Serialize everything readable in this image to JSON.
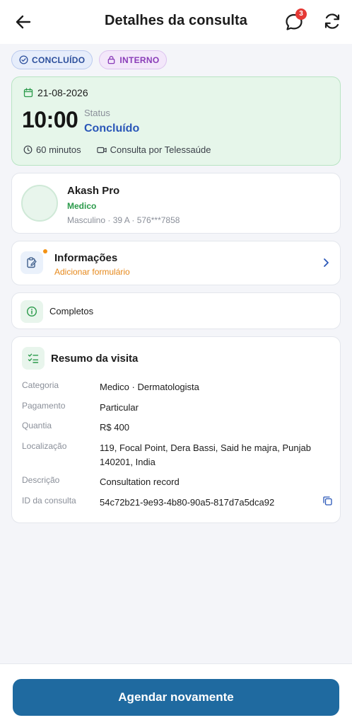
{
  "header": {
    "title": "Detalhes da consulta",
    "chat_badge": "3",
    "icons": {
      "back": "back-arrow-icon",
      "chat": "chat-bubble-icon",
      "refresh": "refresh-icon"
    }
  },
  "chips": [
    {
      "label": "CONCLUÍDO",
      "icon": "check-circle-icon",
      "color": "#2c4f9c"
    },
    {
      "label": "INTERNO",
      "icon": "lock-icon",
      "color": "#8a3cb8"
    }
  ],
  "appointment": {
    "date": "21-08-2026",
    "time": "10:00",
    "status_label": "Status",
    "status_value": "Concluído",
    "duration": "60 minutos",
    "type": "Consulta por Telessaúde"
  },
  "patient": {
    "name": "Akash Pro",
    "role": "Medico",
    "details": "Masculino · 39 A · 576***7858"
  },
  "forms": {
    "label": "Informações",
    "sub": "Adicionar formulário"
  },
  "completed": {
    "label": "Completos"
  },
  "summary": {
    "title": "Resumo da visita",
    "rows": [
      {
        "key": "Categoria",
        "value": "Medico · Dermatologista"
      },
      {
        "key": "Pagamento",
        "value": "Particular"
      },
      {
        "key": "Quantia",
        "value": "R$ 400"
      },
      {
        "key": "Localização",
        "value": "119, Focal Point, Dera Bassi, Said he majra, Punjab 140201, India"
      },
      {
        "key": "Descrição",
        "value": "Consultation record"
      },
      {
        "key": "ID da consulta",
        "value": "54c72b21-9e93-4b80-90a5-817d7a5dca92"
      }
    ]
  },
  "footer": {
    "button": "Agendar novamente"
  },
  "colors": {
    "primary": "#1f6aa0",
    "success_bg": "#e6f6ea",
    "status_blue": "#2a57b8",
    "accent_orange": "#e6881a",
    "badge_red": "#e53935"
  }
}
